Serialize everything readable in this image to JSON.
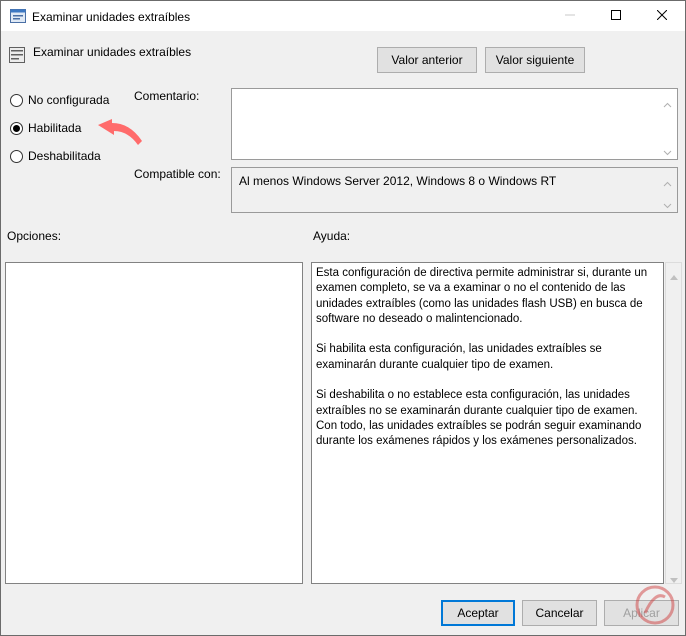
{
  "window": {
    "title": "Examinar unidades extraíbles",
    "minimize_icon": "minimize-icon",
    "maximize_icon": "maximize-icon",
    "close_icon": "close-icon"
  },
  "header": {
    "title": "Examinar unidades extraíbles",
    "icon": "policy-setting-icon"
  },
  "nav": {
    "prev_label": "Valor anterior",
    "next_label": "Valor siguiente"
  },
  "state": {
    "options": [
      {
        "label": "No configurada",
        "checked": false
      },
      {
        "label": "Habilitada",
        "checked": true
      },
      {
        "label": "Deshabilitada",
        "checked": false
      }
    ]
  },
  "annotation": {
    "arrow_color": "#ff6b6b"
  },
  "comment": {
    "label": "Comentario:",
    "value": ""
  },
  "compatible": {
    "label": "Compatible con:",
    "value": "Al menos Windows Server 2012, Windows 8 o Windows RT"
  },
  "options_section": {
    "label": "Opciones:"
  },
  "help_section": {
    "label": "Ayuda:",
    "paragraphs": [
      "Esta configuración de directiva permite administrar si, durante un examen completo, se va a examinar o no el contenido de las unidades extraíbles (como las unidades flash USB) en busca de software no deseado o malintencionado.",
      "Si habilita esta configuración, las unidades extraíbles se examinarán durante cualquier tipo de examen.",
      "Si deshabilita o no establece esta configuración, las unidades extraíbles no se examinarán durante cualquier tipo de examen. Con todo, las unidades extraíbles se podrán seguir examinando durante los exámenes rápidos y los exámenes personalizados."
    ]
  },
  "footer": {
    "ok_label": "Aceptar",
    "cancel_label": "Cancelar",
    "apply_label": "Aplicar"
  },
  "colors": {
    "accent": "#0078d7",
    "window_bg": "#f0f0f0",
    "arrow": "#ff6b6b",
    "watermark": "#d04040"
  }
}
